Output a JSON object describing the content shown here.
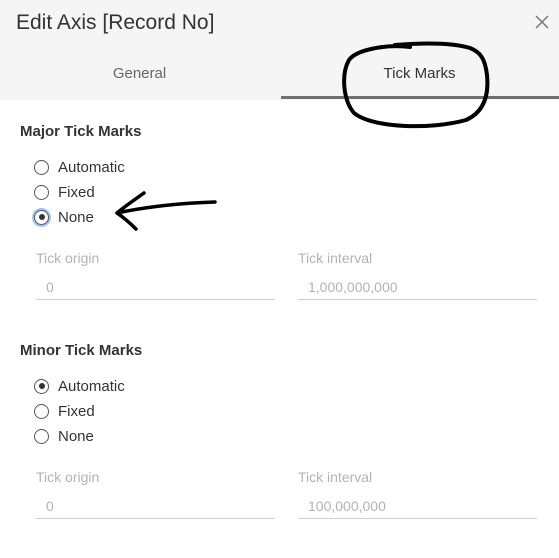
{
  "dialog": {
    "title": "Edit Axis [Record No]",
    "close_icon": "close-icon",
    "tabs": [
      {
        "label": "General",
        "active": false
      },
      {
        "label": "Tick Marks",
        "active": true
      }
    ]
  },
  "major": {
    "title": "Major Tick Marks",
    "options": [
      {
        "label": "Automatic",
        "checked": false
      },
      {
        "label": "Fixed",
        "checked": false
      },
      {
        "label": "None",
        "checked": true
      }
    ],
    "tick_origin": {
      "label": "Tick origin",
      "value": "0"
    },
    "tick_interval": {
      "label": "Tick interval",
      "value": "1,000,000,000"
    }
  },
  "minor": {
    "title": "Minor Tick Marks",
    "options": [
      {
        "label": "Automatic",
        "checked": true
      },
      {
        "label": "Fixed",
        "checked": false
      },
      {
        "label": "None",
        "checked": false
      }
    ],
    "tick_origin": {
      "label": "Tick origin",
      "value": "0"
    },
    "tick_interval": {
      "label": "Tick interval",
      "value": "100,000,000"
    }
  },
  "colors": {
    "header_bg": "#f5f5f5",
    "active_tab_underline": "#707070",
    "disabled_text": "#b3b3b3",
    "focus_ring": "#9ec5ee"
  }
}
